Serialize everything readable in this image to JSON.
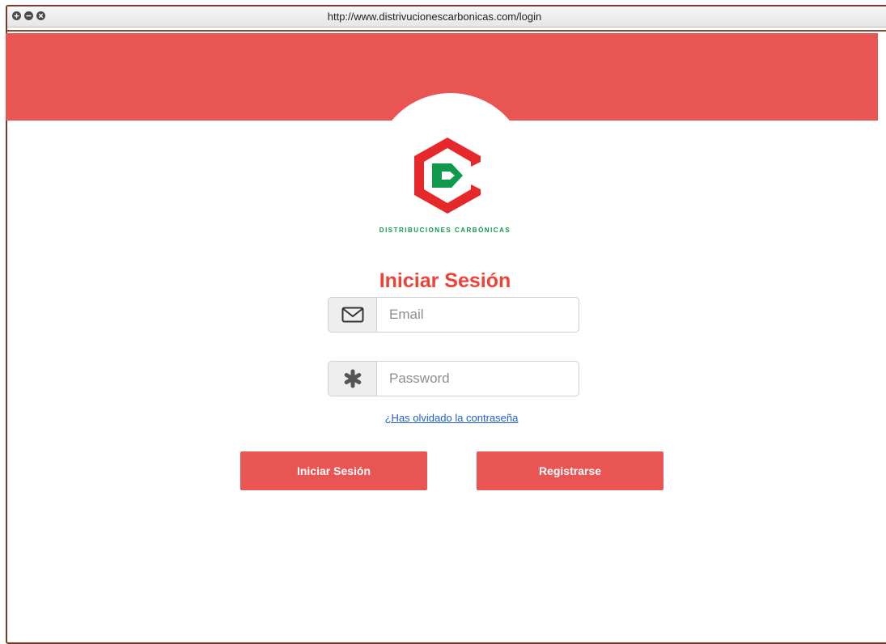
{
  "browser": {
    "url": "http://www.distrivucionescarbonicas.com/login"
  },
  "brand": {
    "name": "DISTRIBUCIONES CARBÓNICAS",
    "colors": {
      "accent": "#e95552",
      "title": "#ee4236",
      "logo_red": "#e6282b",
      "logo_green": "#0e9a4a"
    }
  },
  "login": {
    "title": "Iniciar Sesión",
    "email": {
      "value": "",
      "placeholder": "Email",
      "icon": "envelope-icon"
    },
    "password": {
      "value": "",
      "placeholder": "Password",
      "icon": "asterisk-icon"
    },
    "forgot_link": "¿Has olvidado la contraseña",
    "login_button": "Iniciar Sesión",
    "register_button": "Registrarse"
  }
}
